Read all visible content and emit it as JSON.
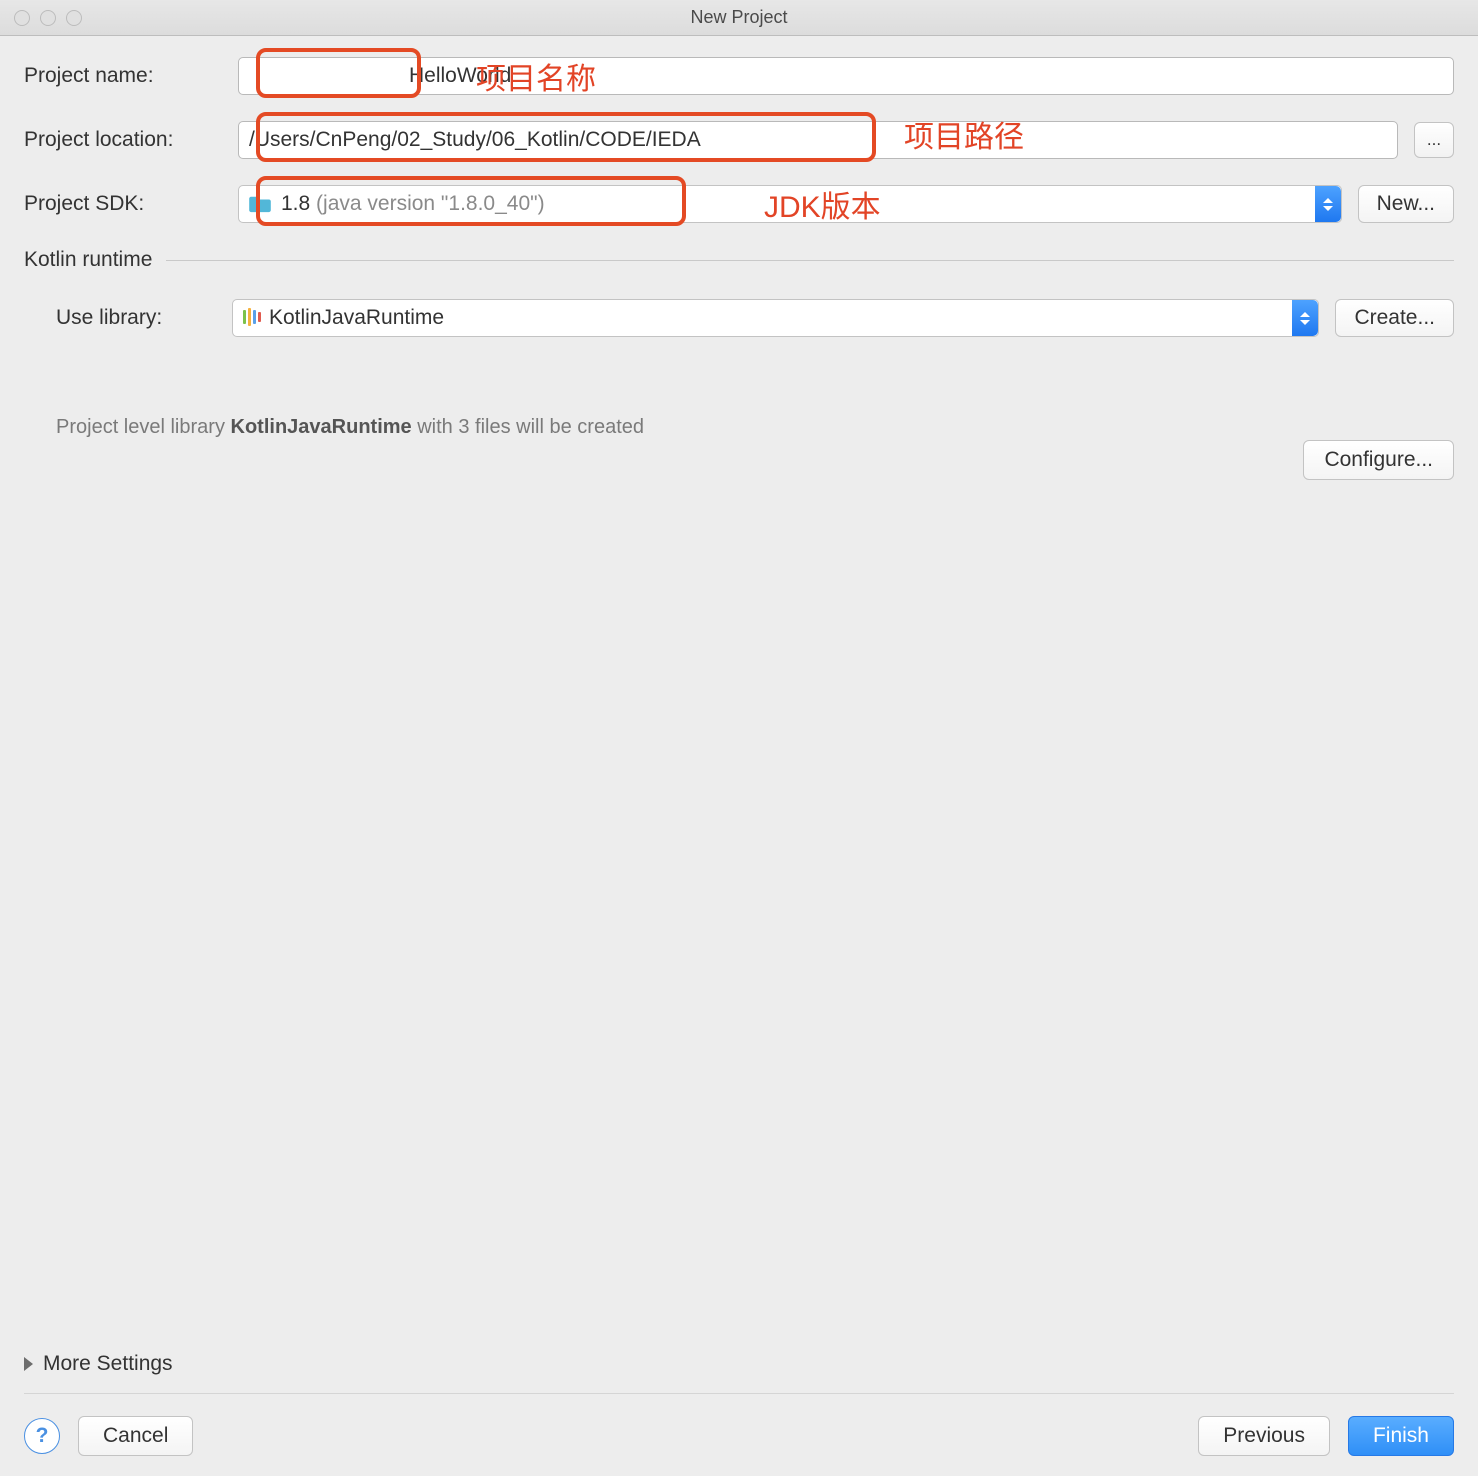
{
  "window": {
    "title": "New Project"
  },
  "fields": {
    "projectName": {
      "label": "Project name:",
      "value": "HelloWorld"
    },
    "projectLocation": {
      "label": "Project location:",
      "value": "/Users/CnPeng/02_Study/06_Kotlin/CODE/IEDA"
    },
    "projectSdk": {
      "label": "Project SDK:",
      "name": "1.8",
      "version": "(java version \"1.8.0_40\")"
    },
    "browseLabel": "...",
    "newSdkLabel": "New..."
  },
  "annotations": {
    "projectName": "项目名称",
    "projectLocation": "项目路径",
    "jdk": "JDK版本"
  },
  "kotlin": {
    "runtimeSection": "Kotlin runtime",
    "useLibraryLabel": "Use library:",
    "libraryName": "KotlinJavaRuntime",
    "createLabel": "Create...",
    "infoPrefix": "Project level library ",
    "infoBold": "KotlinJavaRuntime",
    "infoSuffix": " with 3 files will be created",
    "configureLabel": "Configure..."
  },
  "moreSettings": "More Settings",
  "footer": {
    "help": "?",
    "cancel": "Cancel",
    "previous": "Previous",
    "finish": "Finish"
  }
}
